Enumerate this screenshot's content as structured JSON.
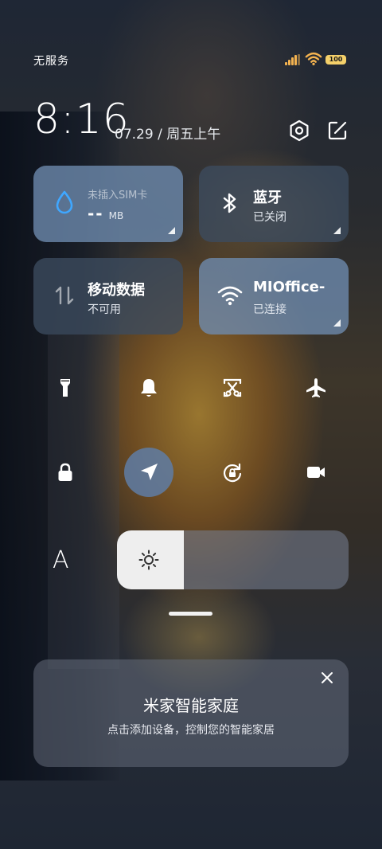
{
  "status_bar": {
    "carrier": "无服务",
    "battery": "100"
  },
  "header": {
    "time": "8:16",
    "date": "07.29 / 周五上午",
    "settings_icon": "hexagon-gear-icon",
    "edit_icon": "edit-icon"
  },
  "tiles": {
    "sim": {
      "label": "未插入SIM卡",
      "value": "--",
      "unit": "MB",
      "icon": "water-drop-icon"
    },
    "bluetooth": {
      "title": "蓝牙",
      "status": "已关闭",
      "icon": "bluetooth-icon"
    },
    "mobile_data": {
      "title": "移动数据",
      "status": "不可用",
      "icon": "data-arrows-icon"
    },
    "wifi": {
      "title": "MIOffice-",
      "status": "已连接",
      "icon": "wifi-icon"
    }
  },
  "toggles": [
    {
      "name": "flashlight",
      "icon": "flashlight-icon",
      "active": false
    },
    {
      "name": "bell",
      "icon": "bell-icon",
      "active": false
    },
    {
      "name": "screenshot",
      "icon": "scissors-screenshot-icon",
      "active": false
    },
    {
      "name": "airplane",
      "icon": "airplane-icon",
      "active": false
    },
    {
      "name": "lock",
      "icon": "lock-icon",
      "active": false
    },
    {
      "name": "location",
      "icon": "location-arrow-icon",
      "active": true
    },
    {
      "name": "rotation-lock",
      "icon": "rotation-lock-icon",
      "active": false
    },
    {
      "name": "video",
      "icon": "video-camera-icon",
      "active": false
    }
  ],
  "brightness": {
    "font_label": "A",
    "level": 0.29,
    "icon": "sun-icon"
  },
  "card": {
    "title": "米家智能家庭",
    "subtitle": "点击添加设备，控制您的智能家居",
    "close_icon": "close-icon"
  },
  "colors": {
    "tile_active": "#6e8caf",
    "tile_inactive": "#3c4b5f",
    "signal": "#f4b350",
    "battery": "#f4d06a"
  }
}
